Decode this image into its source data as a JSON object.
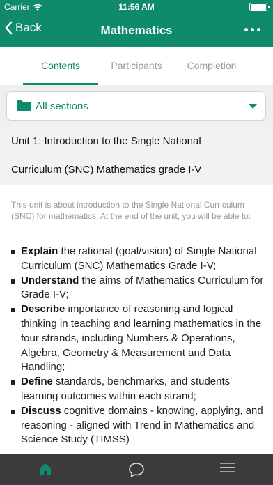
{
  "status_bar": {
    "carrier": "Carrier",
    "time": "11:56 AM"
  },
  "nav": {
    "back_label": "Back",
    "title": "Mathematics"
  },
  "tabs": [
    {
      "label": "Contents",
      "active": true
    },
    {
      "label": "Participants",
      "active": false
    },
    {
      "label": "Completion",
      "active": false
    }
  ],
  "section_picker": {
    "selected": "All sections"
  },
  "unit": {
    "title_line1": "Unit 1: Introduction to the Single National",
    "title_line2": "Curriculum (SNC) Mathematics grade I-V"
  },
  "intro_text": "This unit is about introduction to the Single National Curriculum (SNC) for mathematics. At the end of the unit, you will be able to:",
  "objectives": [
    {
      "verb": "Explain",
      "text": " the rational (goal/vision) of Single National Curriculum (SNC) Mathematics Grade I-V;"
    },
    {
      "verb": "Understand",
      "text": " the aims of Mathematics Curriculum for Grade I-V;"
    },
    {
      "verb": "Describe",
      "text": " importance of reasoning and logical thinking in teaching and learning mathematics in the four strands, including Numbers & Operations, Algebra, Geometry & Measurement and Data Handling;"
    },
    {
      "verb": "Define",
      "text": " standards, benchmarks, and students' learning outcomes within each strand;"
    },
    {
      "verb": "Discuss",
      "text": " cognitive domains - knowing, applying, and reasoning - aligned with Trend in Mathematics and Science Study (TIMSS)"
    }
  ],
  "bottom_bar": {
    "items": [
      "home-icon",
      "chat-icon",
      "menu-icon"
    ]
  },
  "colors": {
    "primary": "#0f8a6c",
    "bottom_bar": "#3b3b3b",
    "muted_text": "#9a9a9a"
  }
}
